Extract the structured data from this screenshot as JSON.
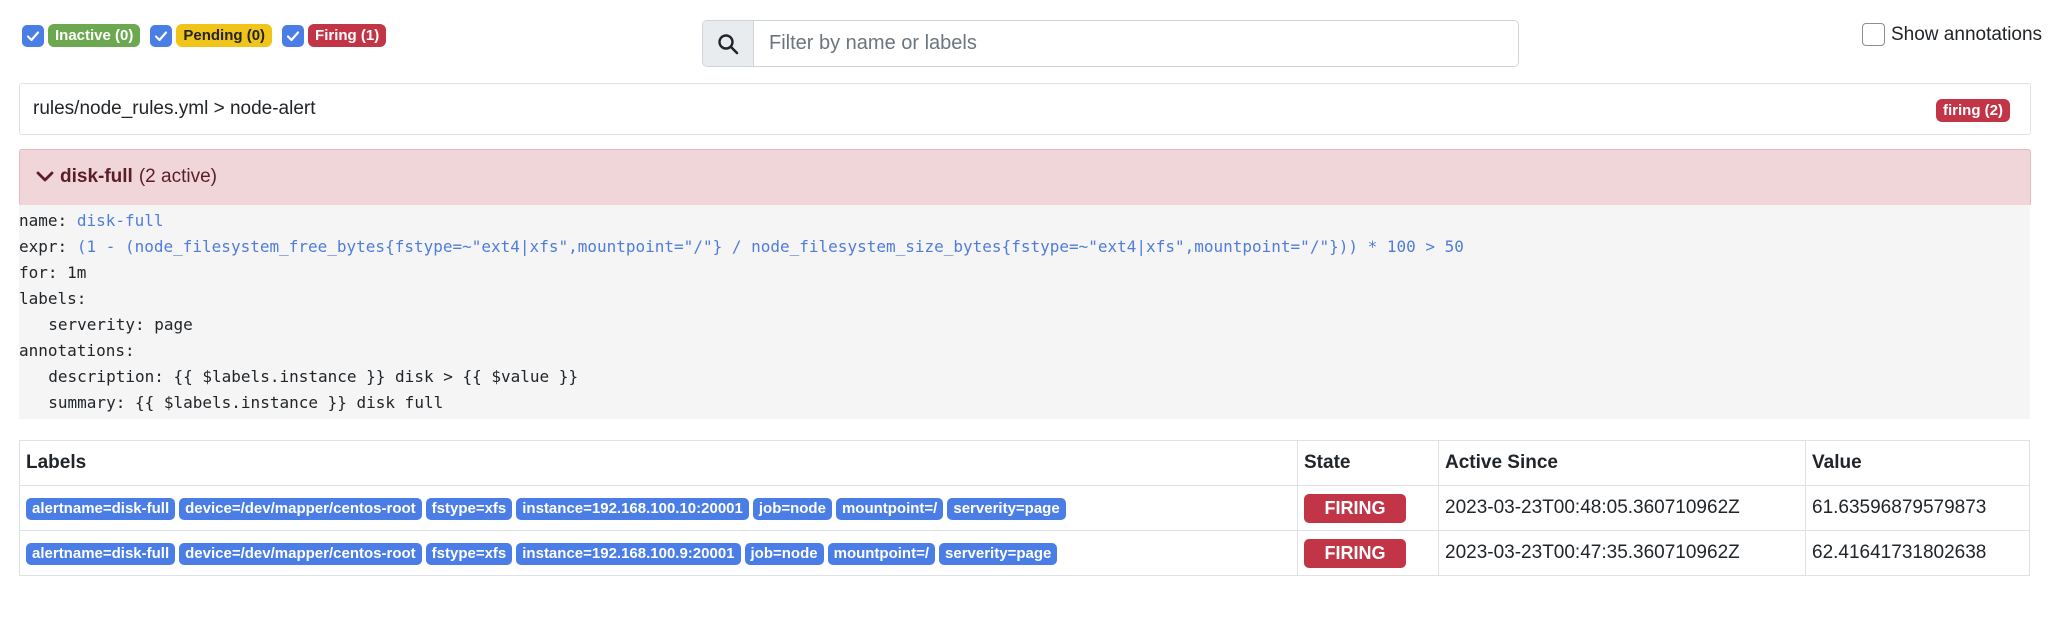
{
  "filters": [
    {
      "label": "Inactive (0)",
      "checked": true,
      "color": "#6ba84f"
    },
    {
      "label": "Pending (0)",
      "checked": true,
      "color": "#f0c419"
    },
    {
      "label": "Firing (1)",
      "checked": true,
      "color": "#c13547"
    }
  ],
  "search": {
    "placeholder": "Filter by name or labels",
    "value": ""
  },
  "annotations_toggle": {
    "label": "Show annotations",
    "checked": false
  },
  "group": {
    "title": "rules/node_rules.yml > node-alert",
    "badge": "firing (2)"
  },
  "rule": {
    "name": "disk-full",
    "active_count": "(2 active)",
    "yaml": {
      "name_key": "name:",
      "name_value": "disk-full",
      "expr_key": "expr:",
      "expr_value": "(1 - (node_filesystem_free_bytes{fstype=~\"ext4|xfs\",mountpoint=\"/\"} / node_filesystem_size_bytes{fstype=~\"ext4|xfs\",mountpoint=\"/\"})) * 100 > 50",
      "for_line": "for: 1m",
      "labels_key": "labels:",
      "labels_line": "  serverity: page",
      "annotations_key": "annotations:",
      "description_line": "  description: {{ $labels.instance }} disk > {{ $value }}",
      "summary_line": "  summary: {{ $labels.instance }} disk full"
    }
  },
  "table": {
    "headers": [
      "Labels",
      "State",
      "Active Since",
      "Value"
    ],
    "rows": [
      {
        "labels": [
          "alertname=disk-full",
          "device=/dev/mapper/centos-root",
          "fstype=xfs",
          "instance=192.168.100.10:20001",
          "job=node",
          "mountpoint=/",
          "serverity=page"
        ],
        "state": "FIRING",
        "active_since": "2023-03-23T00:48:05.360710962Z",
        "value": "61.63596879579873"
      },
      {
        "labels": [
          "alertname=disk-full",
          "device=/dev/mapper/centos-root",
          "fstype=xfs",
          "instance=192.168.100.9:20001",
          "job=node",
          "mountpoint=/",
          "serverity=page"
        ],
        "state": "FIRING",
        "active_since": "2023-03-23T00:47:35.360710962Z",
        "value": "62.41641731802638"
      }
    ]
  },
  "colors": {
    "label_badge": "#4a7de5",
    "firing": "#c13547",
    "rule_header_bg": "#f0d6d9"
  }
}
